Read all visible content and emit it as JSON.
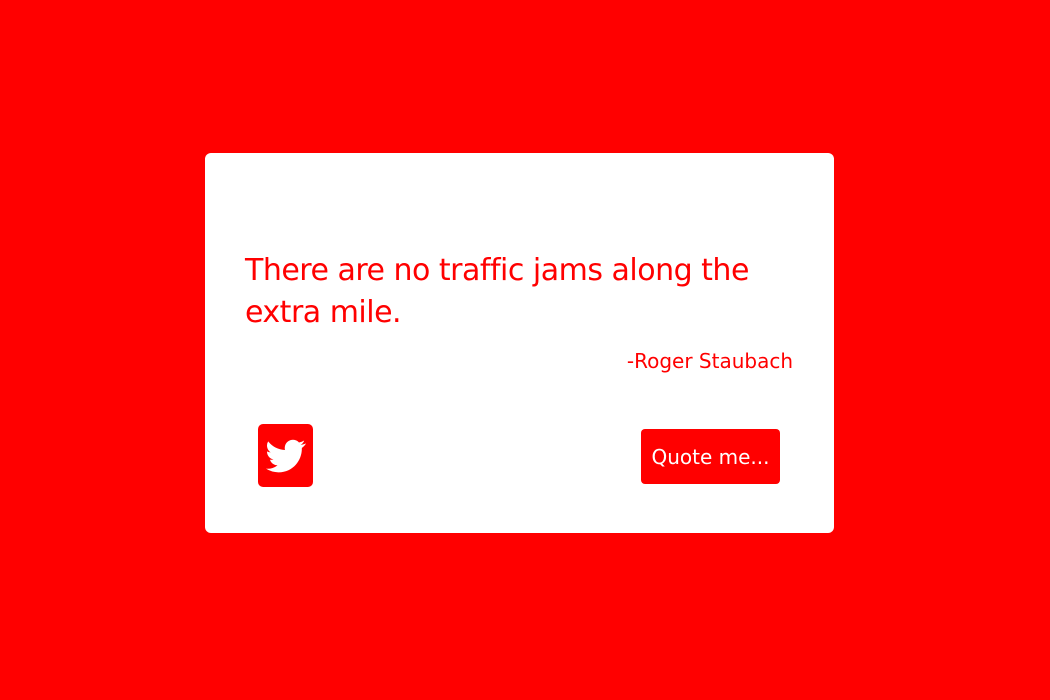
{
  "quote": {
    "text": "There are no traffic jams along the extra mile.",
    "author": "-Roger Staubach"
  },
  "actions": {
    "tweet_icon": "twitter-icon",
    "new_quote_label": "Quote me..."
  },
  "colors": {
    "background": "#ff0000",
    "card": "#ffffff",
    "accent": "#ff0000",
    "button_text": "#ffffff"
  }
}
